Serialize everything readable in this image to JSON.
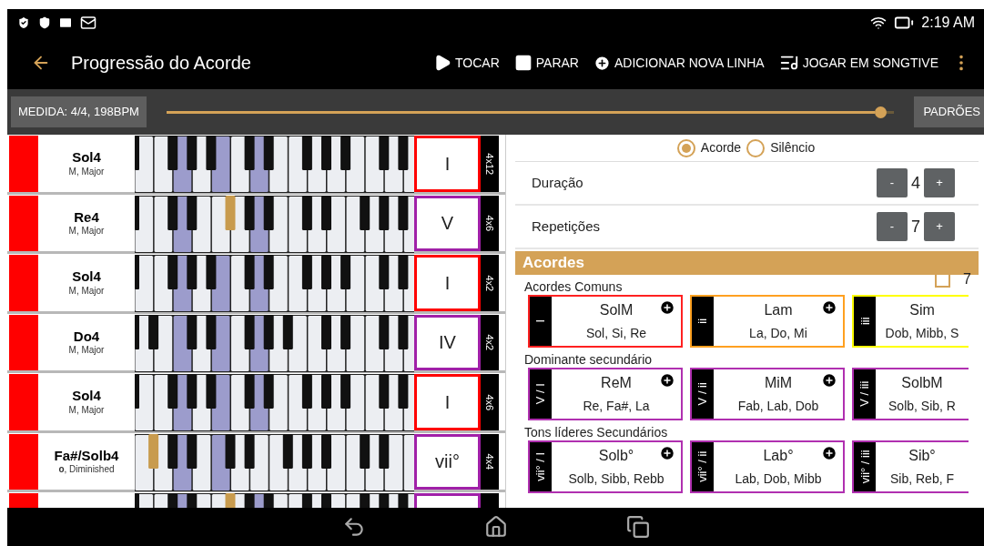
{
  "status_bar": {
    "time": "2:19 AM"
  },
  "toolbar": {
    "title": "Progressão do Acorde",
    "actions": [
      {
        "kind": "play",
        "label": "TOCAR"
      },
      {
        "kind": "stop",
        "label": "PARAR"
      },
      {
        "kind": "add",
        "label": "ADICIONAR NOVA LINHA"
      },
      {
        "kind": "songtive",
        "label": "JOGAR EM SONGTIVE"
      }
    ]
  },
  "measure_bar": {
    "measure_button": "MEDIDA: 4/4, 198BPM",
    "tempo_slider": {
      "level": 0.99
    },
    "defaults_button": "PADRÕES"
  },
  "rows": [
    {
      "name": "Sol4",
      "quality": "M, Major",
      "color": "#ff0000",
      "numeral": {
        "text": "I",
        "color": "#ff0000"
      },
      "repeat": "4x12",
      "edge_sharp": true,
      "white_keys": [
        {
          "highlighted": false,
          "sharp": false,
          "sharp_lit": false
        },
        {
          "highlighted": false,
          "sharp": true,
          "sharp_lit": false
        },
        {
          "highlighted": true,
          "sharp": true,
          "sharp_lit": false
        },
        {
          "highlighted": false,
          "sharp": true,
          "sharp_lit": false
        },
        {
          "highlighted": true,
          "sharp": false,
          "sharp_lit": false
        },
        {
          "highlighted": false,
          "sharp": true,
          "sharp_lit": false
        },
        {
          "highlighted": true,
          "sharp": true,
          "sharp_lit": false
        },
        {
          "highlighted": false,
          "sharp": false,
          "sharp_lit": false
        },
        {
          "highlighted": false,
          "sharp": true,
          "sharp_lit": false
        },
        {
          "highlighted": false,
          "sharp": true,
          "sharp_lit": false
        },
        {
          "highlighted": false,
          "sharp": true,
          "sharp_lit": false
        },
        {
          "highlighted": false,
          "sharp": false,
          "sharp_lit": false
        },
        {
          "highlighted": false,
          "sharp": true,
          "sharp_lit": false
        },
        {
          "highlighted": false,
          "sharp": true,
          "sharp_lit": false
        },
        {
          "highlighted": false,
          "sharp": false,
          "sharp_lit": false
        }
      ]
    },
    {
      "name": "Re4",
      "quality": "M, Major",
      "color": "#ff0000",
      "numeral": {
        "text": "V",
        "color": "#a020a8"
      },
      "repeat": "4x6",
      "edge_sharp": true,
      "white_keys": [
        {
          "highlighted": false,
          "sharp": false,
          "sharp_lit": false
        },
        {
          "highlighted": false,
          "sharp": true,
          "sharp_lit": false
        },
        {
          "highlighted": true,
          "sharp": true,
          "sharp_lit": false
        },
        {
          "highlighted": false,
          "sharp": false,
          "sharp_lit": false
        },
        {
          "highlighted": false,
          "sharp": true,
          "sharp_lit": true
        },
        {
          "highlighted": false,
          "sharp": true,
          "sharp_lit": false
        },
        {
          "highlighted": true,
          "sharp": true,
          "sharp_lit": false
        },
        {
          "highlighted": false,
          "sharp": false,
          "sharp_lit": false
        },
        {
          "highlighted": false,
          "sharp": true,
          "sharp_lit": false
        },
        {
          "highlighted": false,
          "sharp": true,
          "sharp_lit": false
        },
        {
          "highlighted": false,
          "sharp": false,
          "sharp_lit": false
        },
        {
          "highlighted": false,
          "sharp": true,
          "sharp_lit": false
        },
        {
          "highlighted": false,
          "sharp": true,
          "sharp_lit": false
        },
        {
          "highlighted": false,
          "sharp": true,
          "sharp_lit": false
        },
        {
          "highlighted": false,
          "sharp": false,
          "sharp_lit": false
        }
      ]
    },
    {
      "name": "Sol4",
      "quality": "M, Major",
      "color": "#ff0000",
      "numeral": {
        "text": "I",
        "color": "#ff0000"
      },
      "repeat": "4x2",
      "edge_sharp": true,
      "white_keys": [
        {
          "highlighted": false,
          "sharp": false,
          "sharp_lit": false
        },
        {
          "highlighted": false,
          "sharp": true,
          "sharp_lit": false
        },
        {
          "highlighted": true,
          "sharp": true,
          "sharp_lit": false
        },
        {
          "highlighted": false,
          "sharp": true,
          "sharp_lit": false
        },
        {
          "highlighted": true,
          "sharp": false,
          "sharp_lit": false
        },
        {
          "highlighted": false,
          "sharp": true,
          "sharp_lit": false
        },
        {
          "highlighted": true,
          "sharp": true,
          "sharp_lit": false
        },
        {
          "highlighted": false,
          "sharp": false,
          "sharp_lit": false
        },
        {
          "highlighted": false,
          "sharp": true,
          "sharp_lit": false
        },
        {
          "highlighted": false,
          "sharp": true,
          "sharp_lit": false
        },
        {
          "highlighted": false,
          "sharp": true,
          "sharp_lit": false
        },
        {
          "highlighted": false,
          "sharp": false,
          "sharp_lit": false
        },
        {
          "highlighted": false,
          "sharp": true,
          "sharp_lit": false
        },
        {
          "highlighted": false,
          "sharp": true,
          "sharp_lit": false
        },
        {
          "highlighted": false,
          "sharp": false,
          "sharp_lit": false
        }
      ]
    },
    {
      "name": "Do4",
      "quality": "M, Major",
      "color": "#ff0000",
      "numeral": {
        "text": "IV",
        "color": "#a020a8"
      },
      "repeat": "4x2",
      "edge_sharp": true,
      "white_keys": [
        {
          "highlighted": false,
          "sharp": true,
          "sharp_lit": false
        },
        {
          "highlighted": false,
          "sharp": false,
          "sharp_lit": false
        },
        {
          "highlighted": true,
          "sharp": true,
          "sharp_lit": false
        },
        {
          "highlighted": false,
          "sharp": true,
          "sharp_lit": false
        },
        {
          "highlighted": true,
          "sharp": false,
          "sharp_lit": false
        },
        {
          "highlighted": false,
          "sharp": true,
          "sharp_lit": false
        },
        {
          "highlighted": true,
          "sharp": true,
          "sharp_lit": false
        },
        {
          "highlighted": false,
          "sharp": true,
          "sharp_lit": false
        },
        {
          "highlighted": false,
          "sharp": false,
          "sharp_lit": false
        },
        {
          "highlighted": false,
          "sharp": true,
          "sharp_lit": false
        },
        {
          "highlighted": false,
          "sharp": true,
          "sharp_lit": false
        },
        {
          "highlighted": false,
          "sharp": false,
          "sharp_lit": false
        },
        {
          "highlighted": false,
          "sharp": true,
          "sharp_lit": false
        },
        {
          "highlighted": false,
          "sharp": true,
          "sharp_lit": false
        },
        {
          "highlighted": false,
          "sharp": false,
          "sharp_lit": false
        }
      ]
    },
    {
      "name": "Sol4",
      "quality": "M, Major",
      "color": "#ff0000",
      "numeral": {
        "text": "I",
        "color": "#ff0000"
      },
      "repeat": "4x6",
      "edge_sharp": true,
      "white_keys": [
        {
          "highlighted": false,
          "sharp": false,
          "sharp_lit": false
        },
        {
          "highlighted": false,
          "sharp": true,
          "sharp_lit": false
        },
        {
          "highlighted": true,
          "sharp": true,
          "sharp_lit": false
        },
        {
          "highlighted": false,
          "sharp": true,
          "sharp_lit": false
        },
        {
          "highlighted": true,
          "sharp": false,
          "sharp_lit": false
        },
        {
          "highlighted": false,
          "sharp": true,
          "sharp_lit": false
        },
        {
          "highlighted": true,
          "sharp": true,
          "sharp_lit": false
        },
        {
          "highlighted": false,
          "sharp": false,
          "sharp_lit": false
        },
        {
          "highlighted": false,
          "sharp": true,
          "sharp_lit": false
        },
        {
          "highlighted": false,
          "sharp": true,
          "sharp_lit": false
        },
        {
          "highlighted": false,
          "sharp": true,
          "sharp_lit": false
        },
        {
          "highlighted": false,
          "sharp": false,
          "sharp_lit": false
        },
        {
          "highlighted": false,
          "sharp": true,
          "sharp_lit": false
        },
        {
          "highlighted": false,
          "sharp": true,
          "sharp_lit": false
        },
        {
          "highlighted": false,
          "sharp": false,
          "sharp_lit": false
        }
      ]
    },
    {
      "name": "Fa#/Solb4",
      "quality": "**o**, Diminished",
      "color": "#ff0000",
      "numeral": {
        "text": "vii°",
        "color": "#a020a8"
      },
      "repeat": "4x4",
      "edge_sharp": false,
      "white_keys": [
        {
          "highlighted": false,
          "sharp": true,
          "sharp_lit": true
        },
        {
          "highlighted": false,
          "sharp": true,
          "sharp_lit": false
        },
        {
          "highlighted": true,
          "sharp": true,
          "sharp_lit": false
        },
        {
          "highlighted": false,
          "sharp": false,
          "sharp_lit": false
        },
        {
          "highlighted": true,
          "sharp": true,
          "sharp_lit": false
        },
        {
          "highlighted": false,
          "sharp": true,
          "sharp_lit": false
        },
        {
          "highlighted": false,
          "sharp": false,
          "sharp_lit": false
        },
        {
          "highlighted": false,
          "sharp": true,
          "sharp_lit": false
        },
        {
          "highlighted": false,
          "sharp": true,
          "sharp_lit": false
        },
        {
          "highlighted": false,
          "sharp": true,
          "sharp_lit": false
        },
        {
          "highlighted": false,
          "sharp": false,
          "sharp_lit": false
        },
        {
          "highlighted": false,
          "sharp": true,
          "sharp_lit": false
        },
        {
          "highlighted": false,
          "sharp": true,
          "sharp_lit": false
        },
        {
          "highlighted": false,
          "sharp": false,
          "sharp_lit": false
        },
        {
          "highlighted": false,
          "sharp": false,
          "sharp_lit": false
        }
      ]
    },
    {
      "color": "#ff0000",
      "numeral": {
        "color": "#a020a8"
      },
      "edge_sharp": true,
      "white_keys": [
        {
          "highlighted": false,
          "sharp": false,
          "sharp_lit": false
        },
        {
          "highlighted": false,
          "sharp": true,
          "sharp_lit": false
        },
        {
          "highlighted": true,
          "sharp": true,
          "sharp_lit": false
        },
        {
          "highlighted": false,
          "sharp": false,
          "sharp_lit": false
        },
        {
          "highlighted": false,
          "sharp": true,
          "sharp_lit": true
        },
        {
          "highlighted": false,
          "sharp": true,
          "sharp_lit": false
        },
        {
          "highlighted": true,
          "sharp": true,
          "sharp_lit": false
        },
        {
          "highlighted": false,
          "sharp": false,
          "sharp_lit": false
        },
        {
          "highlighted": false,
          "sharp": true,
          "sharp_lit": false
        },
        {
          "highlighted": false,
          "sharp": true,
          "sharp_lit": false
        },
        {
          "highlighted": false,
          "sharp": false,
          "sharp_lit": false
        },
        {
          "highlighted": false,
          "sharp": true,
          "sharp_lit": false
        },
        {
          "highlighted": false,
          "sharp": true,
          "sharp_lit": false
        },
        {
          "highlighted": false,
          "sharp": true,
          "sharp_lit": false
        },
        {
          "highlighted": false,
          "sharp": false,
          "sharp_lit": false
        }
      ]
    }
  ],
  "editor": {
    "type_options": [
      {
        "label": "Acorde",
        "selected": true
      },
      {
        "label": "Silêncio",
        "selected": false
      }
    ],
    "steppers": [
      {
        "label": "Duração",
        "minus": "-",
        "value": "4",
        "plus": "+"
      },
      {
        "label": "Repetições",
        "minus": "-",
        "value": "7",
        "plus": "+"
      }
    ],
    "section_title": "Acordes",
    "seventh": {
      "checked": false,
      "label": "7"
    },
    "groups": [
      {
        "title": "Acordes Comuns",
        "cards": [
          {
            "degree": "I",
            "name": "SolM",
            "notes": "Sol, Si, Re",
            "color": "#ff2020",
            "add": true
          },
          {
            "degree": "ii",
            "name": "Lam",
            "notes": "La, Do, Mi",
            "color": "#ffa020",
            "add": true
          },
          {
            "degree": "iii",
            "name": "Sim",
            "notes": "Dob, Mibb, S",
            "color": "#ffff00",
            "add": false
          }
        ]
      },
      {
        "title": "Dominante secundário",
        "cards": [
          {
            "degree": "V / I",
            "name": "ReM",
            "notes": "Re, Fa#, La",
            "color": "#b030b0",
            "add": true
          },
          {
            "degree": "V / ii",
            "name": "MiM",
            "notes": "Fab, Lab, Dob",
            "color": "#b030b0",
            "add": true
          },
          {
            "degree": "V / iii",
            "name": "SolbM",
            "notes": "Solb, Sib, R",
            "color": "#b030b0",
            "add": false
          }
        ]
      },
      {
        "title": "Tons líderes Secundários",
        "cards": [
          {
            "degree": "vii° / I",
            "name": "Solb°",
            "notes": "Solb, Sibb, Rebb",
            "color": "#b030b0",
            "add": true
          },
          {
            "degree": "vii° / ii",
            "name": "Lab°",
            "notes": "Lab, Dob, Mibb",
            "color": "#b030b0",
            "add": true
          },
          {
            "degree": "vii° / iii",
            "name": "Sib°",
            "notes": "Sib, Reb, F",
            "color": "#b030b0",
            "add": false
          }
        ]
      }
    ]
  }
}
